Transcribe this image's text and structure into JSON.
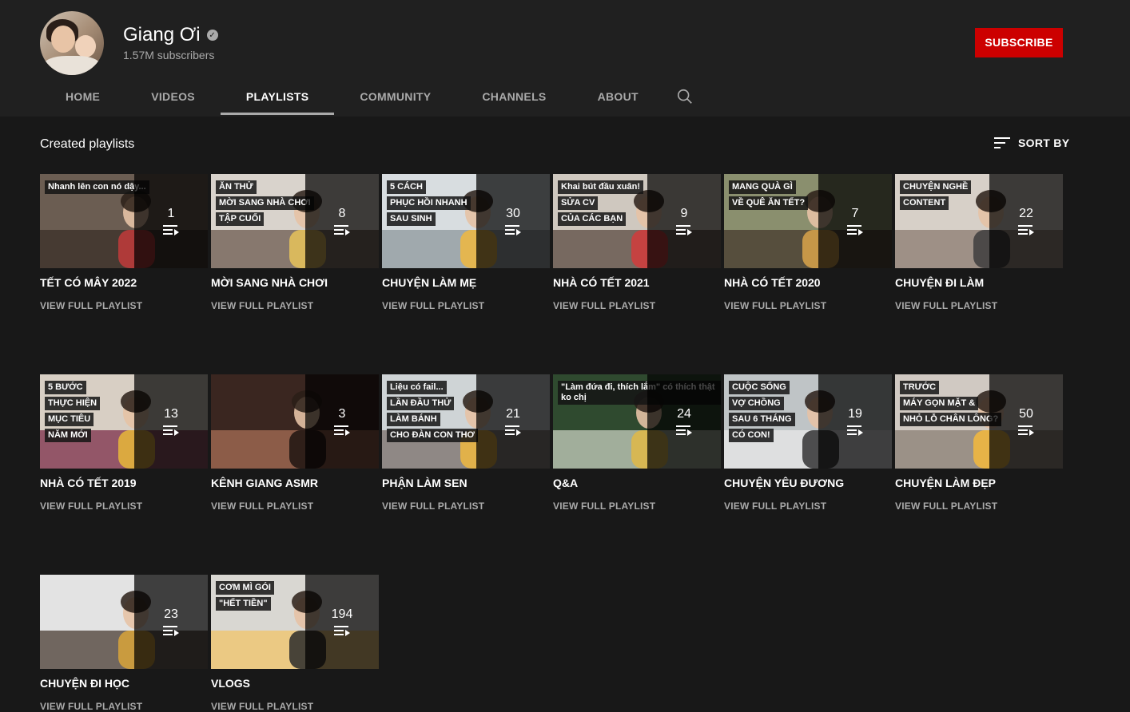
{
  "channel": {
    "name": "Giang Ơi",
    "subscribers": "1.57M subscribers",
    "subscribe_label": "SUBSCRIBE"
  },
  "tabs": [
    {
      "label": "HOME"
    },
    {
      "label": "VIDEOS"
    },
    {
      "label": "PLAYLISTS"
    },
    {
      "label": "COMMUNITY"
    },
    {
      "label": "CHANNELS"
    },
    {
      "label": "ABOUT"
    }
  ],
  "active_tab": "PLAYLISTS",
  "section": {
    "title": "Created playlists",
    "sort_label": "SORT BY"
  },
  "link_label": "VIEW FULL PLAYLIST",
  "playlists": [
    {
      "title": "TẾT CÓ MÂY 2022",
      "count": "1"
    },
    {
      "title": "MỜI SANG NHÀ CHƠI",
      "count": "8"
    },
    {
      "title": "CHUYỆN LÀM MẸ",
      "count": "30"
    },
    {
      "title": "NHÀ CÓ TẾT 2021",
      "count": "9"
    },
    {
      "title": "NHÀ CÓ TẾT 2020",
      "count": "7"
    },
    {
      "title": "CHUYỆN ĐI LÀM",
      "count": "22"
    },
    {
      "title": "NHÀ CÓ TẾT 2019",
      "count": "13"
    },
    {
      "title": "KÊNH GIANG ASMR",
      "count": "3"
    },
    {
      "title": "PHẬN LÀM SEN",
      "count": "21"
    },
    {
      "title": "Q&A",
      "count": "24"
    },
    {
      "title": "CHUYỆN YÊU ĐƯƠNG",
      "count": "19"
    },
    {
      "title": "CHUYỆN LÀM ĐẸP",
      "count": "50"
    },
    {
      "title": "CHUYỆN ĐI HỌC",
      "count": "23"
    },
    {
      "title": "VLOGS",
      "count": "194"
    }
  ],
  "thumb_captions": [
    [
      "Nhanh lên con nó dậy..."
    ],
    [
      "ĂN THỬ",
      "MỜI SANG NHÀ CHƠI",
      "TẬP CUỐI"
    ],
    [
      "5 CÁCH",
      "PHỤC HỒI NHANH",
      "SAU SINH"
    ],
    [
      "Khai bút đầu xuân!",
      "SỬA CV",
      "CỦA CÁC BẠN"
    ],
    [
      "MANG QUÀ GÌ",
      "VỀ QUÊ ĂN TẾT?"
    ],
    [
      "CHUYỆN NGHỀ",
      "CONTENT"
    ],
    [
      "5 BƯỚC",
      "THỰC HIỆN",
      "MỤC TIÊU",
      "NĂM MỚI"
    ],
    [],
    [
      "Liệu có fail...",
      "LẦN ĐẦU THỬ",
      "LÀM BÁNH",
      "CHO ĐÀN CON THƠ"
    ],
    [
      "\"Làm đứa đi, thích lắm\" có thích thật ko chị"
    ],
    [
      "CUỘC SỐNG",
      "VỢ CHỒNG",
      "SAU 6 THÁNG",
      "CÓ CON!"
    ],
    [
      "TRƯỚC",
      "MÁY GỌN MẶT &",
      "NHỎ LỖ CHÂN LÔNG?"
    ],
    [],
    [
      "CƠM MÌ GÓI",
      "\"HẾT TIỀN\""
    ]
  ],
  "colors": {
    "accent": "#cc0000",
    "background": "#181818",
    "header": "#202020"
  }
}
